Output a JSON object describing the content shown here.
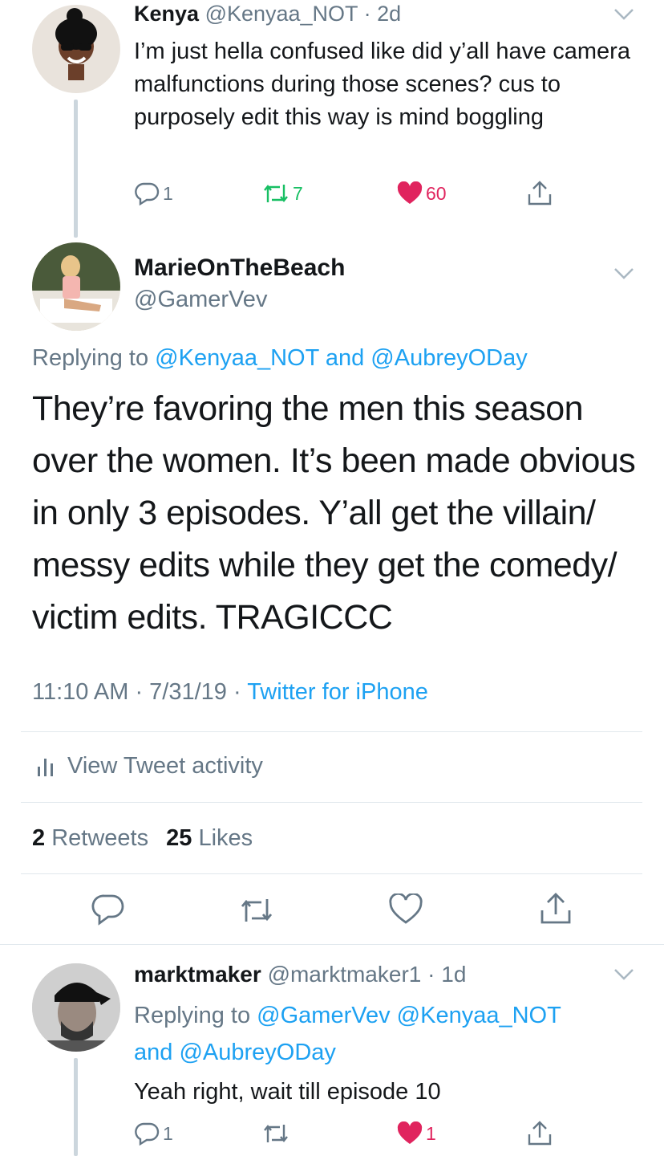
{
  "colors": {
    "text": "#14171a",
    "secondary": "#657786",
    "link": "#1da1f2",
    "retweet": "#17bf63",
    "like": "#e0245e",
    "divider": "#e1e8ed"
  },
  "tweets": [
    {
      "name": "Kenya",
      "handle": "@Kenyaa_NOT",
      "time": "2d",
      "text": "I’m just hella confused like did y’all have camera malfunctions during those scenes? cus to purposely edit this way is mind boggling",
      "replies": "1",
      "retweets": "7",
      "likes": "60"
    },
    {
      "name": "MarieOnTheBeach",
      "handle": "@GamerVev",
      "replying_prefix": "Replying to",
      "replying_to_1": "@Kenyaa_NOT",
      "replying_and": "and",
      "replying_to_2": "@AubreyODay",
      "text": "They’re favoring the men this season over the women. It’s been made obvious in only 3 episodes. Y’all get the villain/ messy edits while they get the comedy/ victim edits. TRAGICCC",
      "time": "11:10 AM",
      "date": "7/31/19",
      "source": "Twitter for iPhone",
      "activity_label": "View Tweet activity",
      "retweet_count": "2",
      "retweet_label": "Retweets",
      "like_count": "25",
      "like_label": "Likes"
    },
    {
      "name": "marktmaker",
      "handle": "@marktmaker1",
      "time": "1d",
      "replying_prefix": "Replying to",
      "replying_to_1": "@GamerVev",
      "replying_to_2": "@Kenyaa_NOT",
      "replying_and": "and",
      "replying_to_3": "@AubreyODay",
      "text": "Yeah right, wait till episode 10",
      "replies": "1",
      "likes": "1"
    }
  ]
}
